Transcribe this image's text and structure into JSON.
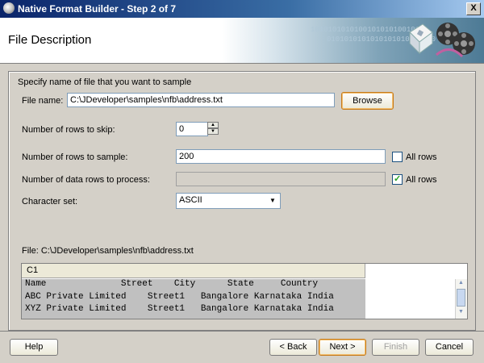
{
  "window": {
    "title": "Native Format Builder - Step 2 of 7",
    "close_label": "X"
  },
  "header": {
    "title": "File Description",
    "banner_binary_1": "1010101010100101010100101",
    "banner_binary_2": "0101010101010101010101010"
  },
  "form": {
    "instruction": "Specify name of file that you want to sample",
    "file_name": {
      "label": "File name:",
      "value": "C:\\JDeveloper\\samples\\nfb\\address.txt"
    },
    "browse_label": "Browse",
    "rows_skip": {
      "label": "Number of rows to skip:",
      "value": "0"
    },
    "rows_sample": {
      "label": "Number of rows to sample:",
      "value": "200",
      "all_rows_label": "All rows",
      "all_rows_checked": false
    },
    "data_rows": {
      "label": "Number of data rows to process:",
      "value": "",
      "all_rows_label": "All rows",
      "all_rows_checked": true
    },
    "charset": {
      "label": "Character set:",
      "value": "ASCII"
    },
    "file_path": "File: C:\\JDeveloper\\samples\\nfb\\address.txt"
  },
  "table": {
    "column_header": "C1",
    "rows": [
      "Name              Street    City      State     Country",
      "ABC Private Limited    Street1   Bangalore Karnataka India",
      "XYZ Private Limited    Street1   Bangalore Karnataka India"
    ]
  },
  "footer": {
    "help_label": "Help",
    "back_label": "< Back",
    "next_label": "Next >",
    "finish_label": "Finish",
    "cancel_label": "Cancel"
  }
}
